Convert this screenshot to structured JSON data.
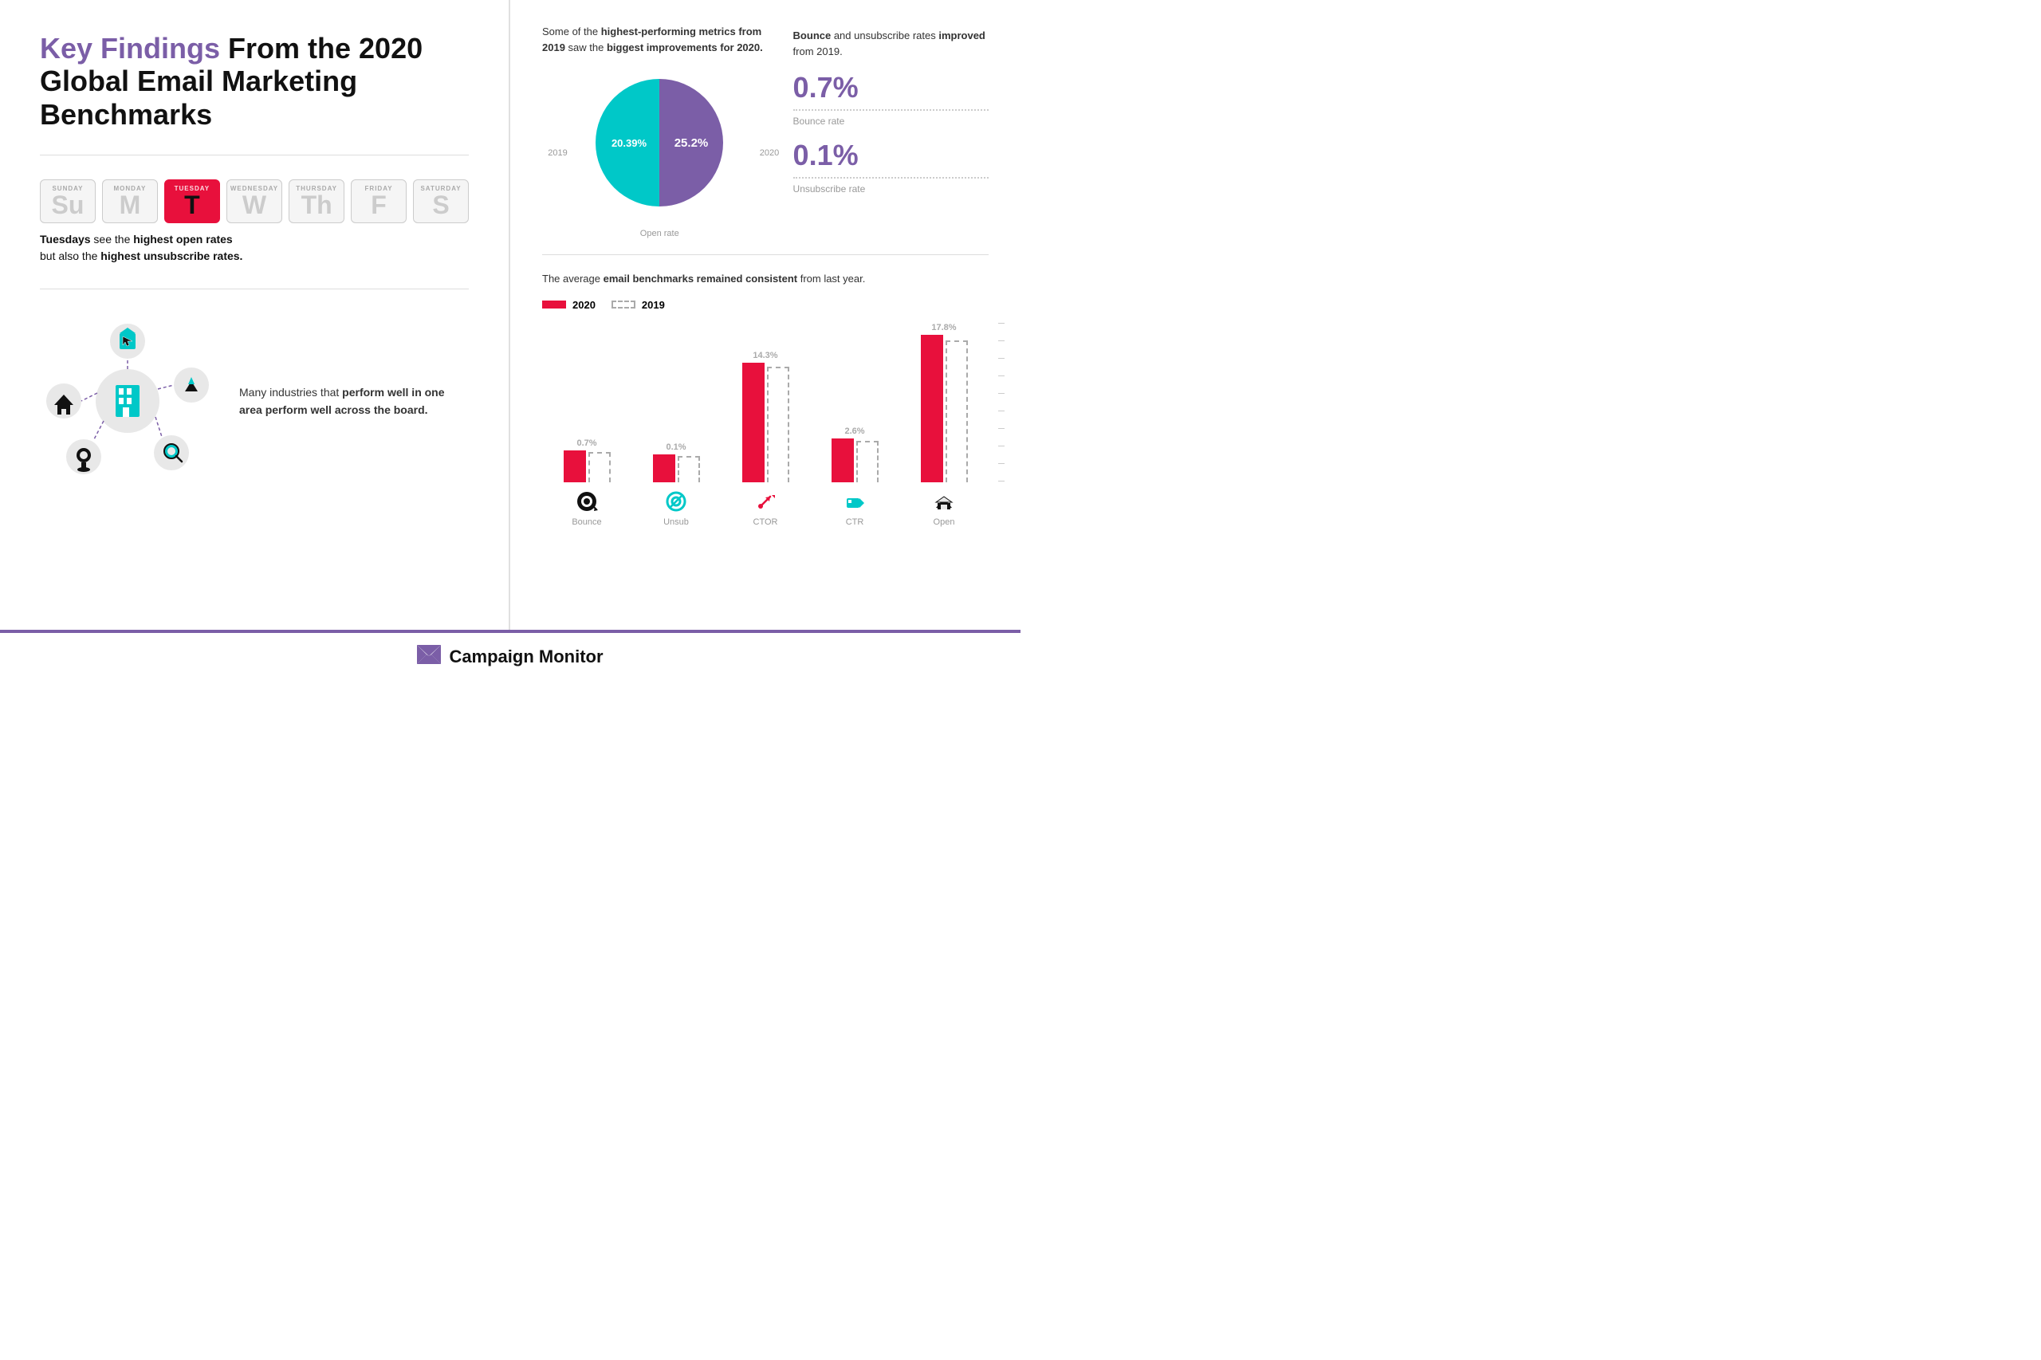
{
  "header": {
    "title_highlight": "Key Findings",
    "title_rest": " From the 2020 Global Email Marketing Benchmarks"
  },
  "days": {
    "cards": [
      {
        "abbr": "SUNDAY",
        "letter": "Su",
        "active": false
      },
      {
        "abbr": "MONDAY",
        "letter": "M",
        "active": false
      },
      {
        "abbr": "TUESDAY",
        "letter": "T",
        "active": true
      },
      {
        "abbr": "WEDNESDAY",
        "letter": "W",
        "active": false
      },
      {
        "abbr": "THURSDAY",
        "letter": "Th",
        "active": false
      },
      {
        "abbr": "FRIDAY",
        "letter": "F",
        "active": false
      },
      {
        "abbr": "SATURDAY",
        "letter": "S",
        "active": false
      }
    ],
    "description_line1": "Tuesdays see the highest open rates",
    "description_line2": "but also the highest unsubscribe rates."
  },
  "industry": {
    "text_prefix": "Many industries that ",
    "text_bold": "perform well in one area perform well across the board."
  },
  "pie_chart": {
    "description_prefix": "Some of the ",
    "description_bold1": "highest-performing metrics from 2019",
    "description_suffix1": " saw the ",
    "description_bold2": "biggest improvements for 2020.",
    "value_2019": "20.39%",
    "value_2020": "25.2%",
    "label_2019": "2019",
    "label_2020": "2020",
    "caption": "Open rate"
  },
  "bounce_unsub": {
    "description_bold1": "Bounce",
    "description_suffix": " and unsubscribe rates ",
    "description_bold2": "improved",
    "description_end": " from 2019.",
    "bounce_value": "0.7%",
    "bounce_label": "Bounce rate",
    "unsub_value": "0.1%",
    "unsub_label": "Unsubscribe rate"
  },
  "bar_chart": {
    "description_prefix": "The average ",
    "description_bold": "email benchmarks remained consistent",
    "description_suffix": " from last year.",
    "legend_2020": "2020",
    "legend_2019": "2019",
    "bars": [
      {
        "name": "Bounce",
        "value_label": "0.7%",
        "solid_height": 40,
        "dashed_height": 38,
        "icon": "bounce"
      },
      {
        "name": "Unsub",
        "value_label": "0.1%",
        "solid_height": 35,
        "dashed_height": 33,
        "icon": "unsub"
      },
      {
        "name": "CTOR",
        "value_label": "14.3%",
        "solid_height": 150,
        "dashed_height": 145,
        "icon": "ctor"
      },
      {
        "name": "CTR",
        "value_label": "2.6%",
        "solid_height": 55,
        "dashed_height": 52,
        "icon": "ctr"
      },
      {
        "name": "Open",
        "value_label": "17.8%",
        "solid_height": 185,
        "dashed_height": 180,
        "icon": "open"
      }
    ]
  },
  "footer": {
    "brand": "Campaign Monitor"
  }
}
